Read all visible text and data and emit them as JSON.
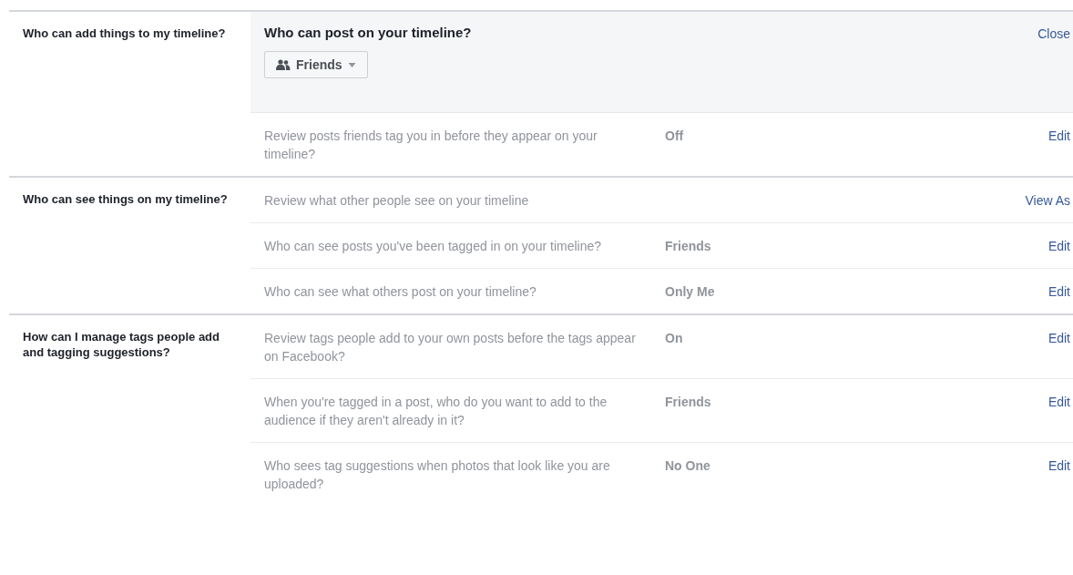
{
  "sections": [
    {
      "label": "Who can add things to my timeline?",
      "rows": [
        {
          "kind": "expanded",
          "title": "Who can post on your timeline?",
          "dropdown": "Friends",
          "action": "Close"
        },
        {
          "kind": "setting",
          "description": "Review posts friends tag you in before they appear on your timeline?",
          "value": "Off",
          "action": "Edit"
        }
      ]
    },
    {
      "label": "Who can see things on my timeline?",
      "rows": [
        {
          "kind": "setting",
          "description": "Review what other people see on your timeline",
          "action": "View As"
        },
        {
          "kind": "setting",
          "description": "Who can see posts you've been tagged in on your timeline?",
          "value": "Friends",
          "action": "Edit"
        },
        {
          "kind": "setting",
          "description": "Who can see what others post on your timeline?",
          "value": "Only Me",
          "action": "Edit"
        }
      ]
    },
    {
      "label": "How can I manage tags people add and tagging suggestions?",
      "rows": [
        {
          "kind": "setting",
          "description": "Review tags people add to your own posts before the tags appear on Facebook?",
          "value": "On",
          "action": "Edit"
        },
        {
          "kind": "setting",
          "description": "When you're tagged in a post, who do you want to add to the audience if they aren't already in it?",
          "value": "Friends",
          "action": "Edit"
        },
        {
          "kind": "setting",
          "description": "Who sees tag suggestions when photos that look like you are uploaded?",
          "value": "No One",
          "action": "Edit"
        }
      ]
    }
  ]
}
